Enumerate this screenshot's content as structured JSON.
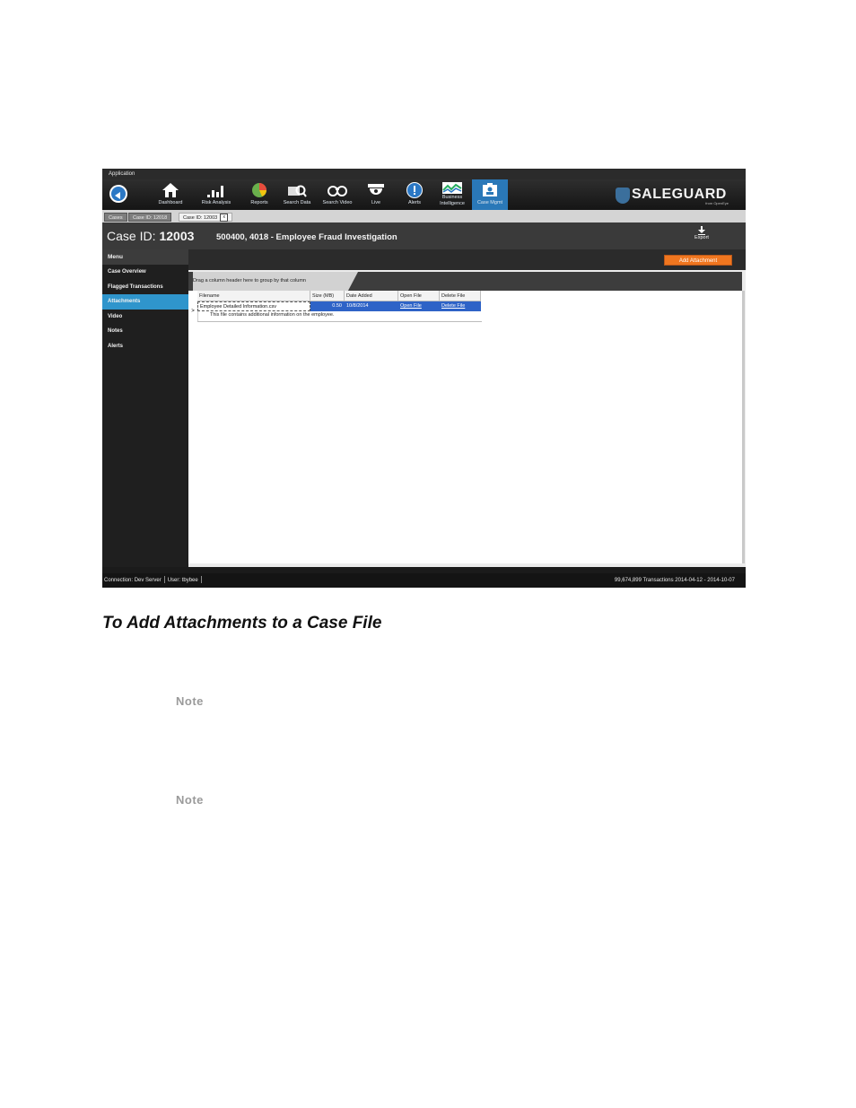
{
  "app": {
    "title_bar": "Application",
    "toolbar": [
      {
        "label": "Dashboard",
        "icon": "home-icon"
      },
      {
        "label": "Risk Analysis",
        "icon": "bar-chart-icon"
      },
      {
        "label": "Reports",
        "icon": "pie-chart-icon"
      },
      {
        "label": "Search Data",
        "icon": "search-data-icon"
      },
      {
        "label": "Search Video",
        "icon": "binoculars-icon"
      },
      {
        "label": "Live",
        "icon": "dome-camera-icon"
      },
      {
        "label": "Alerts",
        "icon": "alert-icon"
      },
      {
        "label": "Business Intelligence",
        "icon": "bi-graph-icon"
      },
      {
        "label": "Case Mgmt",
        "icon": "case-icon"
      }
    ],
    "logo": {
      "text": "SALEGUARD",
      "sub": "from OpenEye"
    },
    "tabs": [
      "Cases",
      "Case ID: 12018",
      "Case ID: 12003"
    ],
    "tab_close": "x",
    "case": {
      "id_label": "Case ID:",
      "id": "12003",
      "title": "500400, 4018 - Employee Fraud Investigation",
      "export_label": "Export"
    },
    "menu": {
      "header": "Menu",
      "items": [
        "Case Overview",
        "Flagged Transactions",
        "Attachments",
        "Video",
        "Notes",
        "Alerts"
      ],
      "active": "Attachments"
    },
    "add_attachment_label": "Add Attachment",
    "group_hint": "Drag a column header here to group by that column",
    "grid": {
      "columns": [
        "Filename",
        "Size (MB)",
        "Date Added",
        "Open File",
        "Delete File"
      ],
      "rows": [
        {
          "filename": "Employee Detailed Information.csv",
          "size": "0.50",
          "date": "10/8/2014",
          "open": "Open File",
          "delete": "Delete File",
          "detail": "This file contains additional information on the employee."
        }
      ],
      "row_indicator": ">"
    },
    "status": {
      "connection": "Connection: Dev Server",
      "user": "User: tbybee",
      "transactions": "99,674,899 Transactions 2014-04-12 - 2014-10-07"
    }
  },
  "document": {
    "heading": "To Add Attachments to a Case File",
    "notes": [
      "Note",
      "Note"
    ]
  },
  "colors": {
    "accent": "#2a78b8",
    "add_button": "#f0761f",
    "menu_active": "#2f95cc",
    "selected_row": "#2e63c7"
  }
}
